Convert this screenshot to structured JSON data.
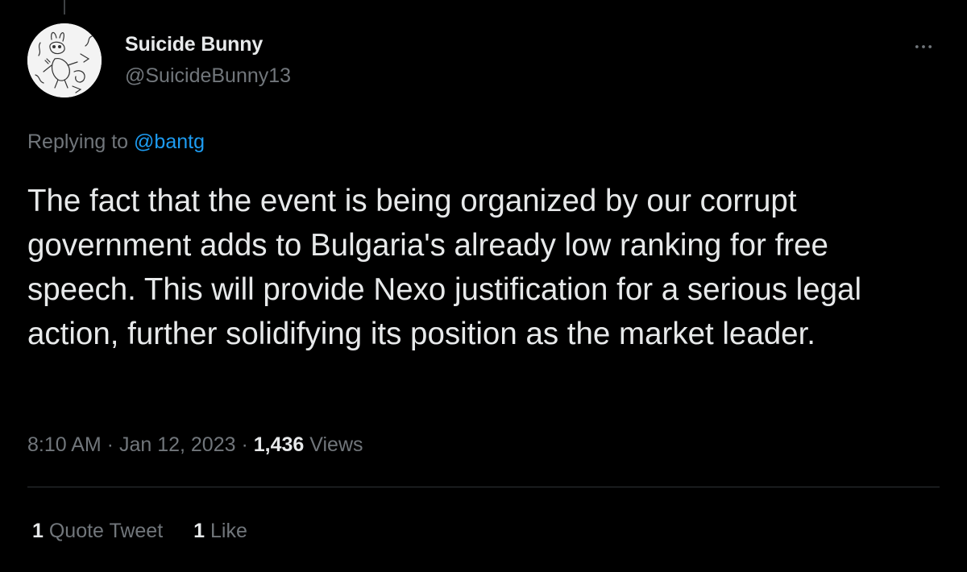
{
  "author": {
    "display_name": "Suicide Bunny",
    "handle": "@SuicideBunny13"
  },
  "reply": {
    "prefix": "Replying to",
    "mention": "@bantg"
  },
  "tweet": {
    "text": "The fact that the event is being organized by our corrupt government adds to Bulgaria's already low ranking for free speech. This will provide Nexo justification for a serious legal action, further solidifying its position as the market leader."
  },
  "meta": {
    "time": "8:10 AM",
    "sep1": " · ",
    "date": "Jan 12, 2023",
    "sep2": " · ",
    "views_count": "1,436",
    "views_label": " Views"
  },
  "stats": {
    "quote_count": "1",
    "quote_label": " Quote Tweet",
    "like_count": "1",
    "like_label": " Like"
  },
  "icons": {
    "more": "more-horizontal-icon",
    "avatar": "bunny-sketch-avatar"
  },
  "colors": {
    "background": "#000000",
    "text_primary": "#e7e9ea",
    "text_secondary": "#71767b",
    "link": "#1d9bf0",
    "divider": "#2f3336"
  }
}
